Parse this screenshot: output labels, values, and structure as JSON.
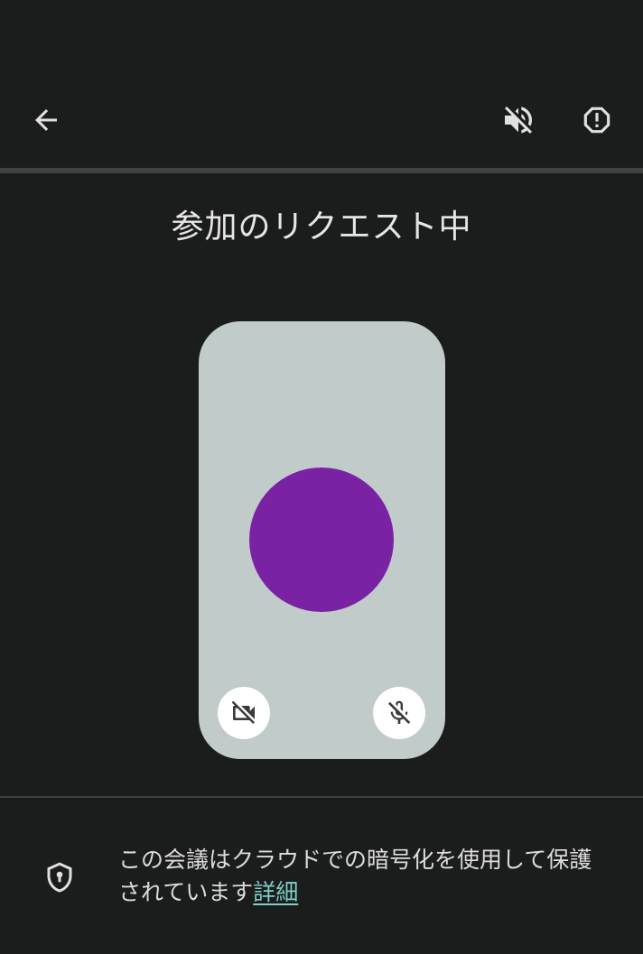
{
  "header": {
    "back_icon": "arrow-back-icon",
    "speaker_icon": "volume-off-icon",
    "report_icon": "report-octagon-icon"
  },
  "title": "参加のリクエスト中",
  "preview": {
    "avatar_color": "#7a22a4",
    "card_color": "#c1cbca",
    "camera_icon": "videocam-off-icon",
    "mic_icon": "mic-off-icon"
  },
  "footer": {
    "shield_icon": "encryption-shield-icon",
    "notice_text": "この会議はクラウドでの暗号化を使用して保護されています",
    "learn_more_link": "詳細"
  },
  "colors": {
    "background": "#1b1c1c",
    "link": "#7fcfc8"
  }
}
